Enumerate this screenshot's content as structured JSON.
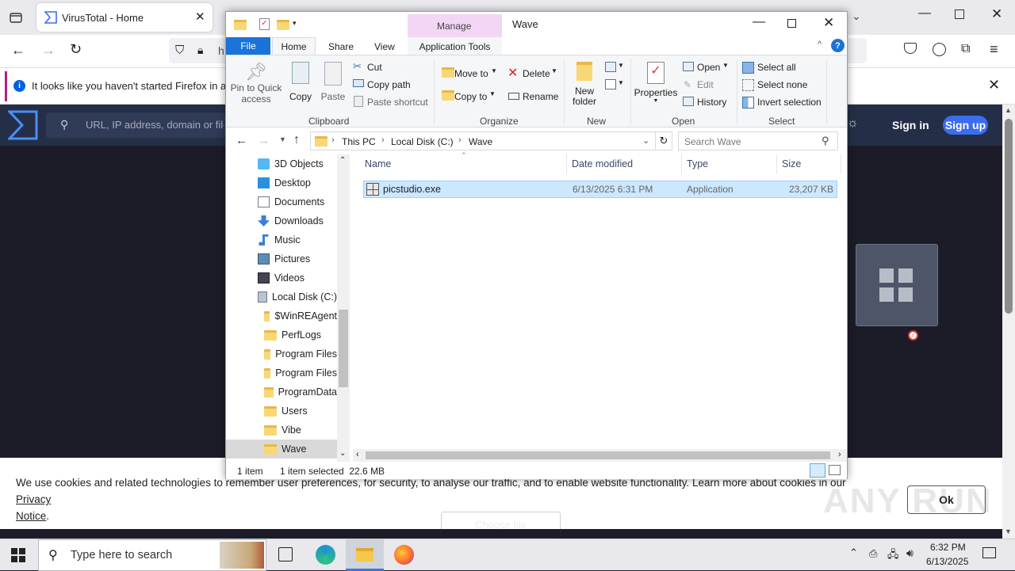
{
  "browser": {
    "tab_title": "VirusTotal - Home",
    "url_partial": "h",
    "notice_text": "It looks like you haven't started Firefox in a wh"
  },
  "vt": {
    "search_placeholder": "URL, IP address, domain or file",
    "sign_in": "Sign in",
    "sign_up": "Sign up",
    "choose_file": "Choose file"
  },
  "cookie": {
    "text": "We use cookies and related technologies to remember user preferences, for security, to analyse our traffic, and to enable website functionality. Learn more about cookies in our ",
    "link1": "Privacy",
    "link2": "Notice",
    "period": ".",
    "ok": "Ok"
  },
  "explorer": {
    "title": "Wave",
    "manage_tab": "Manage",
    "tabs": [
      "File",
      "Home",
      "Share",
      "View",
      "Application Tools"
    ],
    "ribbon": {
      "pin": "Pin to Quick access",
      "copy": "Copy",
      "paste": "Paste",
      "cut": "Cut",
      "copy_path": "Copy path",
      "paste_shortcut": "Paste shortcut",
      "clipboard": "Clipboard",
      "move_to": "Move to",
      "copy_to": "Copy to",
      "delete": "Delete",
      "rename": "Rename",
      "organize": "Organize",
      "new_folder_1": "New",
      "new_folder_2": "folder",
      "new": "New",
      "properties": "Properties",
      "open": "Open",
      "edit": "Edit",
      "history": "History",
      "open_group": "Open",
      "select_all": "Select all",
      "select_none": "Select none",
      "invert_selection": "Invert selection",
      "select_group": "Select"
    },
    "breadcrumb": [
      "This PC",
      "Local Disk (C:)",
      "Wave"
    ],
    "search_placeholder": "Search Wave",
    "nav": [
      "3D Objects",
      "Desktop",
      "Documents",
      "Downloads",
      "Music",
      "Pictures",
      "Videos",
      "Local Disk (C:)",
      "$WinREAgent",
      "PerfLogs",
      "Program Files",
      "Program Files",
      "ProgramData",
      "Users",
      "Vibe",
      "Wave"
    ],
    "columns": [
      "Name",
      "Date modified",
      "Type",
      "Size"
    ],
    "files": [
      {
        "name": "picstudio.exe",
        "date": "6/13/2025 6:31 PM",
        "type": "Application",
        "size": "23,207 KB"
      }
    ],
    "status_items": "1 item",
    "status_selected": "1 item selected  22.6 MB"
  },
  "taskbar": {
    "search_placeholder": "Type here to search",
    "time": "6:32 PM",
    "date": "6/13/2025"
  },
  "watermark": "ANY RUN"
}
